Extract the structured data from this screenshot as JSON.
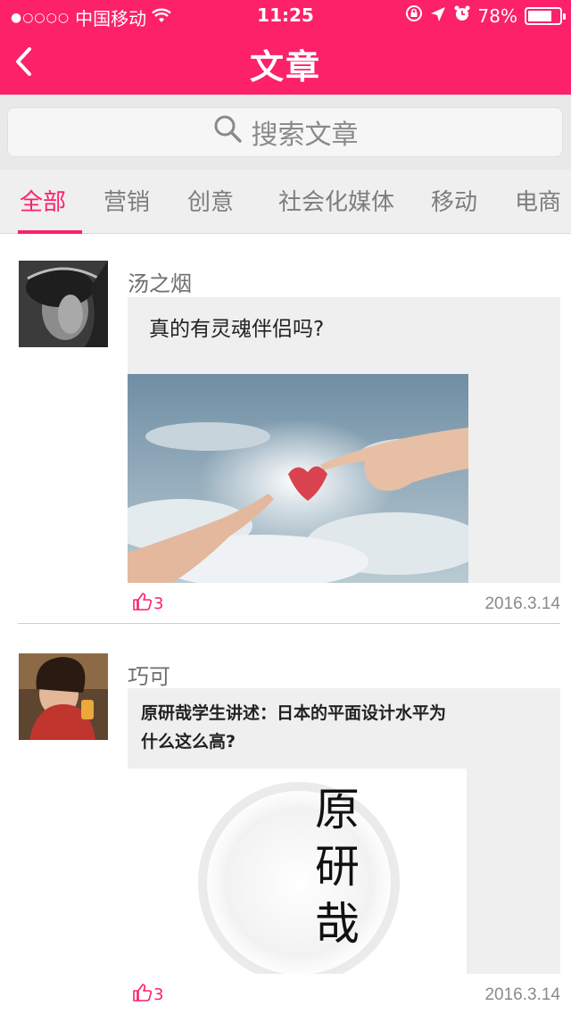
{
  "status_bar": {
    "signal_dots": "●○○○○",
    "carrier": "中国移动",
    "time": "11:25",
    "battery_text": "78%",
    "battery_level": 0.78
  },
  "header": {
    "title": "文章",
    "back_icon": "chevron-left-icon"
  },
  "search": {
    "placeholder": "搜索文章",
    "icon": "search-icon"
  },
  "tabs": [
    {
      "label": "全部",
      "active": true
    },
    {
      "label": "营销",
      "active": false
    },
    {
      "label": "创意",
      "active": false
    },
    {
      "label": "社会化媒体",
      "active": false
    },
    {
      "label": "移动",
      "active": false
    },
    {
      "label": "电商",
      "active": false
    }
  ],
  "posts": [
    {
      "author": "汤之烟",
      "title": "真的有灵魂伴侣吗?",
      "likes": "3",
      "date": "2016.3.14"
    },
    {
      "author": "巧可",
      "title_line1": "原研哉学生讲述：日本的平面设计水平为",
      "title_line2": "什么这么高?",
      "likes": "3",
      "date": "2016.3.14",
      "image_text": [
        "原",
        "研",
        "哉"
      ]
    }
  ],
  "colors": {
    "accent": "#fc2169",
    "header_bg": "#fc2169",
    "content_bg": "#efefef"
  }
}
